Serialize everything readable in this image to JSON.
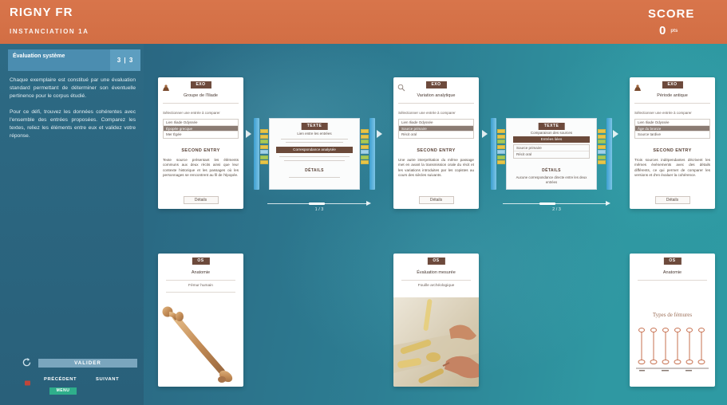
{
  "theme": {
    "header_bg": "#d8754b",
    "sidebar_bg": "#2b6781",
    "accent": "#4b8db0",
    "card_tag": "#6d4a3c",
    "menu_green": "#2fae8b"
  },
  "header": {
    "title": "RIGNY FR",
    "subtitle": "INSTANCIATION 1A",
    "score_label": "SCORE",
    "score_value": "0",
    "score_unit": "pts"
  },
  "sidebar": {
    "panel_title": "Évaluation système",
    "page_indicator": "3 | 3",
    "paragraphs": [
      "Chaque exemplaire est constitué par une évaluation standard permettant de déterminer son éventuelle pertinence pour le corpus étudié.",
      "Pour ce défi, trouvez les données cohérentes avec l'ensemble des entrées proposées. Comparez les textes, reliez les éléments entre eux et validez votre réponse."
    ],
    "validate_label": "VALIDER",
    "prev_label": "PRÉCÉDENT",
    "next_label": "SUIVANT",
    "menu_label": "MENU",
    "icons": {
      "reset": "refresh-icon",
      "flag": "flag-icon"
    }
  },
  "top_cards": [
    {
      "icon": "artifact-icon",
      "tag": "EXO",
      "title": "Groupe de l'Iliade",
      "intro": "Sélectionner une entrée à comparer",
      "rows": [
        "Lien Iliade Odyssée",
        "Épopée grecque",
        "Mer Égée"
      ],
      "selected_row": 1,
      "section": "SECOND ENTRY",
      "body": "Texte source présentant les éléments communs aux deux récits ainsi que leur contexte historique et les passages où les personnages se rencontrent au fil de l'épopée.",
      "button": "Détails"
    },
    {
      "icon": "search-icon",
      "tag": "EXO",
      "title": "Variation analytique",
      "intro": "Sélectionner une entrée à comparer",
      "rows": [
        "Lien Iliade Odyssée",
        "Source primaire",
        "Récit oral"
      ],
      "selected_row": 1,
      "section": "SECOND ENTRY",
      "body": "Une autre interprétation du même passage met en avant la transmission orale du récit et les variations introduites par les copistes au cours des siècles suivants.",
      "button": "Détails"
    },
    {
      "icon": "artifact-icon",
      "tag": "EXO",
      "title": "Période antique",
      "intro": "Sélectionner une entrée à comparer",
      "rows": [
        "Lien Iliade Odyssée",
        "Âge du bronze",
        "Source tardive"
      ],
      "selected_row": 1,
      "section": "SECOND ENTRY",
      "body": "Trois sources indépendantes décrivent les mêmes événements avec des détails différents, ce qui permet de comparer les versions et d'en évaluer la cohérence.",
      "button": "Détails"
    }
  ],
  "comparators": [
    {
      "tag": "TEXTE",
      "caption": "Lien entre les entrées",
      "bar": "Correspondance analysée",
      "details": "DÉTAILS",
      "position": "1 / 3",
      "progress": 0.5
    },
    {
      "tag": "TEXTE",
      "caption": "Comparaison des sources",
      "bar": "Entrées liées",
      "rows": [
        "Source primaire",
        "Récit oral"
      ],
      "details": "DÉTAILS",
      "note": "Aucune correspondance directe entre les deux entrées",
      "position": "2 / 3",
      "progress": 0.42
    }
  ],
  "bottom_cards": [
    {
      "tag": "OS",
      "title": "Anatomie",
      "subtitle": "Fémur humain"
    },
    {
      "tag": "OS",
      "title": "Évaluation mesurée",
      "subtitle": "Fouille archéologique"
    },
    {
      "tag": "OS",
      "title": "Anatomie",
      "caption": "Types de fémures"
    }
  ]
}
